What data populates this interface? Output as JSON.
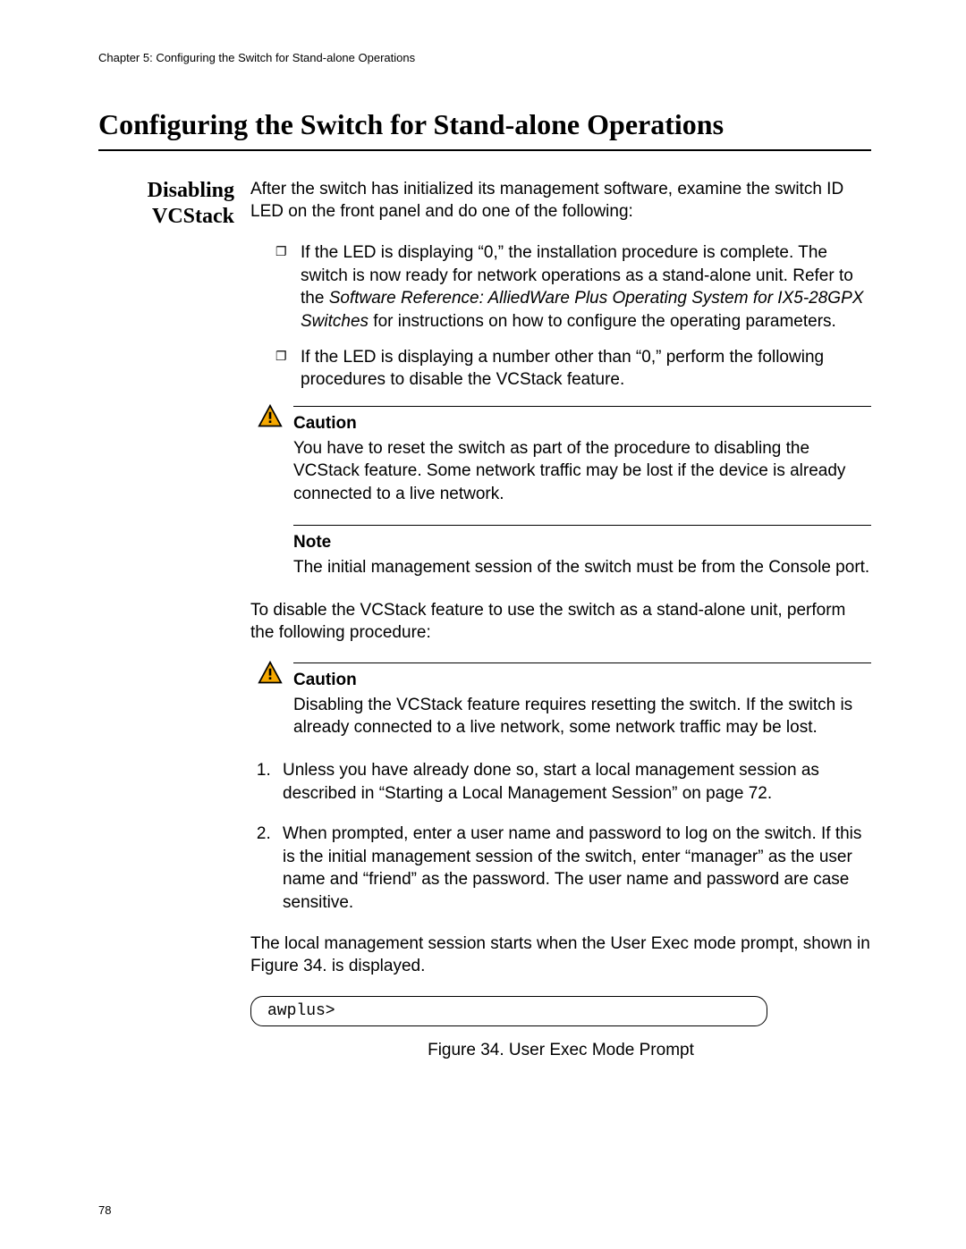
{
  "running_head": "Chapter 5: Configuring the Switch for Stand-alone Operations",
  "section_title": "Configuring the Switch for Stand-alone Operations",
  "side_heading_line1": "Disabling",
  "side_heading_line2": "VCStack",
  "intro_para": "After the switch has initialized its management software, examine the switch ID LED on the front panel and do one of the following:",
  "bullet1_pre": "If the LED is displaying “0,” the installation procedure is complete. The switch is now ready for network operations as a stand-alone unit. Refer to the ",
  "bullet1_italic": "Software Reference: AlliedWare Plus Operating System for IX5-28GPX Switches",
  "bullet1_post": " for instructions on how to configure the operating parameters.",
  "bullet2": "If the LED is displaying a number other than “0,” perform the following procedures to disable the VCStack feature.",
  "caution1_title": "Caution",
  "caution1_text": "You have to reset the switch as part of the procedure to disabling the VCStack feature. Some network traffic may be lost if the device is already connected to a live network.",
  "note_title": "Note",
  "note_text": "The initial management session of the switch must be from the Console port.",
  "para_disable": "To disable the VCStack feature to use the switch as a stand-alone unit, perform the following procedure:",
  "caution2_title": "Caution",
  "caution2_text": "Disabling the VCStack feature requires resetting the switch. If the switch is already connected to a live network, some network traffic may be lost.",
  "step1": "Unless you have already done so, start a local management session as described in “Starting a Local Management Session” on page 72.",
  "step2": "When prompted, enter a user name and password to log on the switch. If this is the initial management session of the switch, enter “manager” as the user name and “friend” as the password. The user name and password are case sensitive.",
  "step2_extra": "The local management session starts when the User Exec mode prompt, shown in Figure 34. is displayed.",
  "prompt": "awplus>",
  "figure_caption": "Figure 34. User Exec Mode Prompt",
  "page_number": "78"
}
